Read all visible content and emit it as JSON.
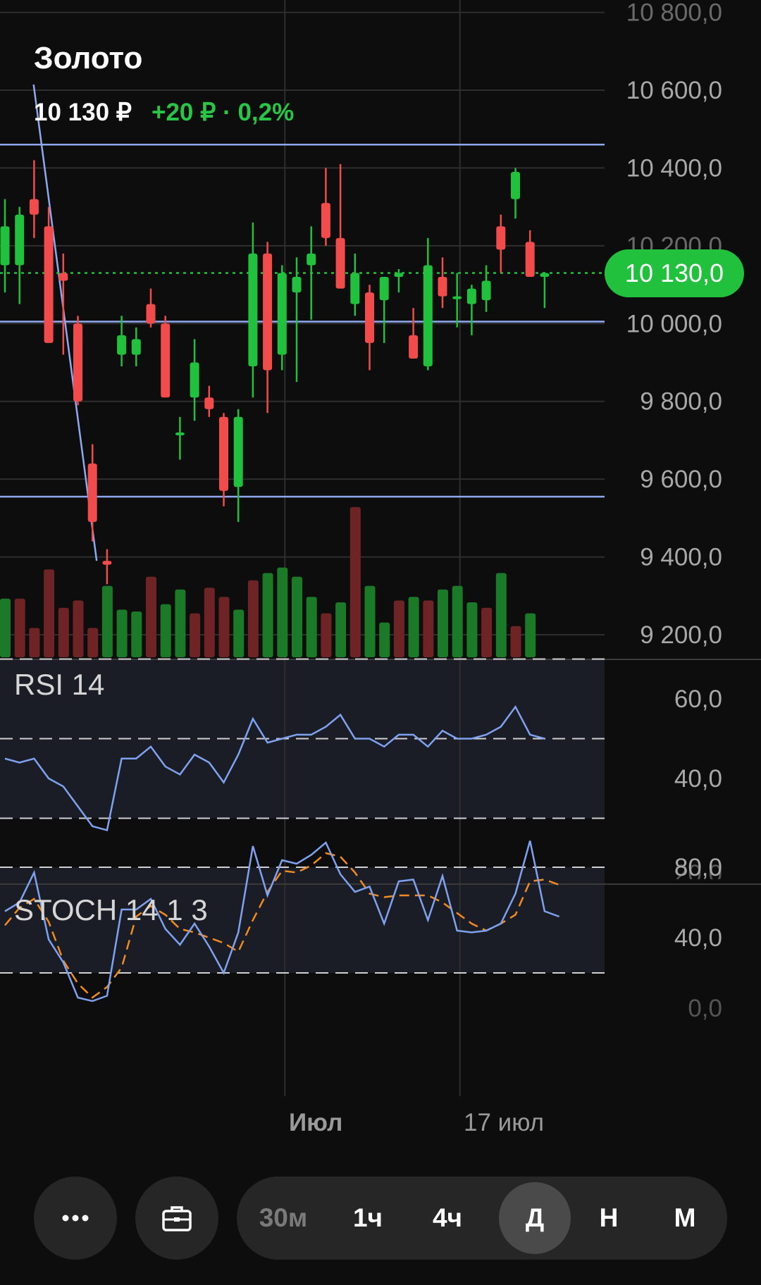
{
  "header": {
    "title": "Золото",
    "price": "10 130 ₽",
    "change": "+20 ₽ · 0,2%"
  },
  "current_price_badge": "10 130,0",
  "colors": {
    "up": "#21c13e",
    "down": "#f24b4b",
    "volume_up": "#1a7a27",
    "volume_down": "#6e2424",
    "drawing_line": "#8ea9f0",
    "rsi_line": "#7fa2ef",
    "stoch_d_line": "#f28a22"
  },
  "chart_data": [
    {
      "type": "candlestick",
      "title": "Золото",
      "y_axis_ticks": [
        "10 800,0",
        "10 600,0",
        "10 400,0",
        "10 200,0",
        "10 000,0",
        "9 800,0",
        "9 600,0",
        "9 400,0",
        "9 200,0"
      ],
      "ylim": [
        9150,
        10820
      ],
      "last_price": 10130,
      "horizontal_levels": [
        10460,
        10005,
        9555
      ],
      "trend_line": [
        [
          10600,
          1
        ],
        [
          9390,
          6
        ]
      ],
      "x_tick_labels": [
        {
          "label": "Июл",
          "index": 19
        },
        {
          "label": "17 июл",
          "index": 31
        }
      ],
      "candles": [
        {
          "o": 10150,
          "h": 10320,
          "l": 10080,
          "c": 10250
        },
        {
          "o": 10150,
          "h": 10300,
          "l": 10050,
          "c": 10280
        },
        {
          "o": 10320,
          "h": 10420,
          "l": 10220,
          "c": 10280
        },
        {
          "o": 10250,
          "h": 10300,
          "l": 9960,
          "c": 9950
        },
        {
          "o": 10130,
          "h": 10180,
          "l": 9920,
          "c": 10110
        },
        {
          "o": 10000,
          "h": 10020,
          "l": 9790,
          "c": 9800
        },
        {
          "o": 9640,
          "h": 9690,
          "l": 9440,
          "c": 9490
        },
        {
          "o": 9390,
          "h": 9420,
          "l": 9330,
          "c": 9380
        },
        {
          "o": 9920,
          "h": 10020,
          "l": 9890,
          "c": 9970
        },
        {
          "o": 9920,
          "h": 9990,
          "l": 9890,
          "c": 9960
        },
        {
          "o": 10050,
          "h": 10090,
          "l": 9990,
          "c": 10000
        },
        {
          "o": 10000,
          "h": 10020,
          "l": 9820,
          "c": 9810
        },
        {
          "o": 9720,
          "h": 9760,
          "l": 9650,
          "c": 9720
        },
        {
          "o": 9810,
          "h": 9960,
          "l": 9750,
          "c": 9900
        },
        {
          "o": 9810,
          "h": 9840,
          "l": 9760,
          "c": 9780
        },
        {
          "o": 9760,
          "h": 9770,
          "l": 9530,
          "c": 9570
        },
        {
          "o": 9580,
          "h": 9780,
          "l": 9490,
          "c": 9760
        },
        {
          "o": 9890,
          "h": 10260,
          "l": 9810,
          "c": 10180
        },
        {
          "o": 10180,
          "h": 10210,
          "l": 9770,
          "c": 9880
        },
        {
          "o": 9920,
          "h": 10150,
          "l": 9880,
          "c": 10130
        },
        {
          "o": 10080,
          "h": 10170,
          "l": 9850,
          "c": 10120
        },
        {
          "o": 10150,
          "h": 10250,
          "l": 10010,
          "c": 10180
        },
        {
          "o": 10310,
          "h": 10400,
          "l": 10200,
          "c": 10220
        },
        {
          "o": 10220,
          "h": 10410,
          "l": 10100,
          "c": 10090
        },
        {
          "o": 10050,
          "h": 10180,
          "l": 10020,
          "c": 10130
        },
        {
          "o": 10080,
          "h": 10100,
          "l": 9880,
          "c": 9950
        },
        {
          "o": 10060,
          "h": 10120,
          "l": 9950,
          "c": 10120
        },
        {
          "o": 10120,
          "h": 10140,
          "l": 10080,
          "c": 10130
        },
        {
          "o": 9970,
          "h": 10040,
          "l": 9910,
          "c": 9910
        },
        {
          "o": 9890,
          "h": 10220,
          "l": 9880,
          "c": 10150
        },
        {
          "o": 10120,
          "h": 10170,
          "l": 10040,
          "c": 10070
        },
        {
          "o": 10070,
          "h": 10130,
          "l": 9990,
          "c": 10070
        },
        {
          "o": 10050,
          "h": 10100,
          "l": 9970,
          "c": 10090
        },
        {
          "o": 10060,
          "h": 10150,
          "l": 10030,
          "c": 10110
        },
        {
          "o": 10250,
          "h": 10280,
          "l": 10130,
          "c": 10190
        },
        {
          "o": 10320,
          "h": 10400,
          "l": 10270,
          "c": 10390
        },
        {
          "o": 10210,
          "h": 10240,
          "l": 10130,
          "c": 10120
        },
        {
          "o": 10120,
          "h": 10130,
          "l": 10040,
          "c": 10130
        }
      ],
      "volume": [
        {
          "v": 0.32,
          "up": true
        },
        {
          "v": 0.32,
          "up": false
        },
        {
          "v": 0.16,
          "up": false
        },
        {
          "v": 0.48,
          "up": false
        },
        {
          "v": 0.27,
          "up": false
        },
        {
          "v": 0.31,
          "up": false
        },
        {
          "v": 0.16,
          "up": false
        },
        {
          "v": 0.39,
          "up": true
        },
        {
          "v": 0.26,
          "up": true
        },
        {
          "v": 0.25,
          "up": true
        },
        {
          "v": 0.44,
          "up": false
        },
        {
          "v": 0.29,
          "up": true
        },
        {
          "v": 0.37,
          "up": true
        },
        {
          "v": 0.24,
          "up": false
        },
        {
          "v": 0.38,
          "up": false
        },
        {
          "v": 0.33,
          "up": false
        },
        {
          "v": 0.26,
          "up": true
        },
        {
          "v": 0.42,
          "up": false
        },
        {
          "v": 0.46,
          "up": true
        },
        {
          "v": 0.49,
          "up": true
        },
        {
          "v": 0.44,
          "up": true
        },
        {
          "v": 0.33,
          "up": true
        },
        {
          "v": 0.24,
          "up": false
        },
        {
          "v": 0.3,
          "up": true
        },
        {
          "v": 0.82,
          "up": false
        },
        {
          "v": 0.39,
          "up": true
        },
        {
          "v": 0.19,
          "up": true
        },
        {
          "v": 0.31,
          "up": false
        },
        {
          "v": 0.33,
          "up": true
        },
        {
          "v": 0.31,
          "up": false
        },
        {
          "v": 0.37,
          "up": true
        },
        {
          "v": 0.39,
          "up": true
        },
        {
          "v": 0.3,
          "up": true
        },
        {
          "v": 0.27,
          "up": false
        },
        {
          "v": 0.46,
          "up": true
        },
        {
          "v": 0.17,
          "up": false
        },
        {
          "v": 0.24,
          "up": true
        }
      ]
    },
    {
      "type": "line",
      "title": "RSI 14",
      "y_axis_ticks": [
        "60,0",
        "40,0"
      ],
      "ylim": [
        27,
        76
      ],
      "reference_lines": [
        70,
        50,
        30
      ],
      "series": [
        {
          "values": [
            45,
            44,
            45,
            40,
            38,
            33,
            28,
            27,
            45,
            45,
            48,
            43,
            41,
            46,
            44,
            39,
            46,
            55,
            49,
            50,
            51,
            51,
            53,
            56,
            50,
            50,
            48,
            51,
            51,
            48,
            52,
            50,
            50,
            51,
            53,
            58,
            51,
            50
          ]
        }
      ]
    },
    {
      "type": "line",
      "title": "STOCH 14 1 3",
      "y_axis_ticks": [
        "80,0",
        "40,0",
        "0,0"
      ],
      "ylim": [
        -3,
        106
      ],
      "reference_lines": [
        80,
        20
      ],
      "series": [
        {
          "name": "%K",
          "values": [
            55,
            60,
            77,
            39,
            26,
            6,
            4,
            7,
            56,
            56,
            62,
            45,
            36,
            48,
            35,
            20,
            43,
            92,
            64,
            84,
            82,
            87,
            94,
            76,
            66,
            69,
            48,
            72,
            73,
            50,
            75,
            44,
            43,
            44,
            48,
            65,
            95,
            55,
            52
          ]
        },
        {
          "name": "%D",
          "values": [
            47,
            57,
            62,
            49,
            27,
            14,
            6,
            12,
            23,
            52,
            58,
            53,
            45,
            43,
            40,
            37,
            32,
            50,
            66,
            78,
            77,
            81,
            88,
            86,
            77,
            65,
            63,
            64,
            64,
            64,
            60,
            54,
            48,
            44,
            48,
            53,
            72,
            73,
            70
          ]
        }
      ]
    }
  ],
  "x_axis": {
    "label_july": "Июл",
    "label_17": "17 июл"
  },
  "indicators": {
    "rsi_label": "RSI 14",
    "stoch_label": "STOCH 14 1 3"
  },
  "toolbar": {
    "more_icon": "ellipsis-icon",
    "portfolio_icon": "briefcase-icon",
    "timeframes": [
      "30м",
      "1ч",
      "4ч",
      "Д",
      "Н",
      "М"
    ],
    "active_timeframe": "Д"
  }
}
